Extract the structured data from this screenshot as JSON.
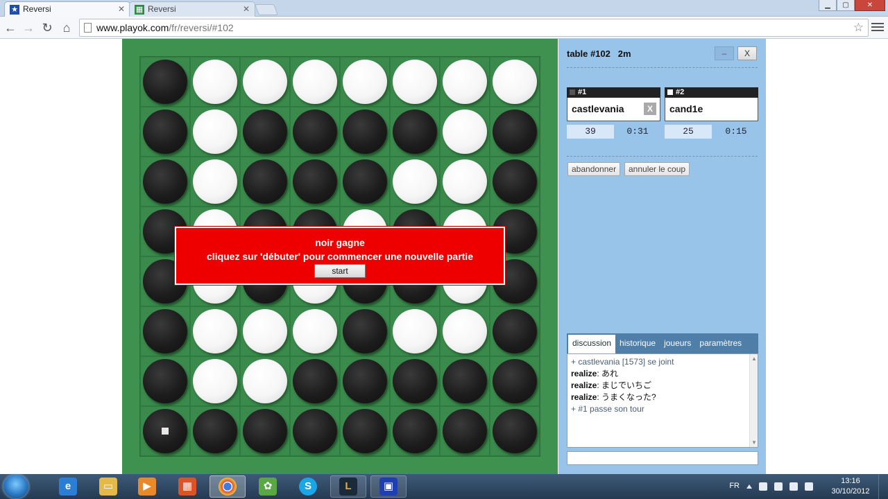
{
  "browser": {
    "tabs": [
      {
        "label": "Reversi",
        "active": true
      },
      {
        "label": "Reversi",
        "active": false
      }
    ],
    "url_host": "www.playok.com",
    "url_path": "/fr/reversi/#102"
  },
  "game": {
    "board": [
      "BWWWWWWW",
      "BWBBBBWB",
      "BWBBBWWB",
      "BWBBWBWB",
      "BWBWBBWB",
      "BWWWBWWB",
      "BWWBBBBB",
      "BBBBBBBB"
    ],
    "last_move": [
      7,
      0
    ],
    "overlay": {
      "line1": "noir gagne",
      "line2": "cliquez sur 'débuter' pour commencer une nouvelle partie",
      "start_label": "start"
    }
  },
  "panel": {
    "title": "table #102   2m",
    "minimize_label": "–",
    "close_label": "X",
    "seat1": {
      "num": "#1",
      "name": "castlevania",
      "kick": "X",
      "score": "39",
      "clock": "0:31"
    },
    "seat2": {
      "num": "#2",
      "name": "cand1e",
      "score": "25",
      "clock": "0:15"
    },
    "resign_label": "abandonner",
    "undo_label": "annuler le coup",
    "chat_tabs": [
      "discussion",
      "historique",
      "joueurs",
      "paramètres"
    ],
    "chat": [
      {
        "type": "sys",
        "text": "+ castlevania [1573] se joint"
      },
      {
        "type": "msg",
        "nick": "realize",
        "text": ": あれ"
      },
      {
        "type": "msg",
        "nick": "realize",
        "text": ": まじでいちご"
      },
      {
        "type": "msg",
        "nick": "realize",
        "text": ": うまくなった?"
      },
      {
        "type": "sys",
        "text": "+ #1 passe son tour"
      }
    ]
  },
  "taskbar": {
    "lang": "FR",
    "time": "13:16",
    "date": "30/10/2012"
  },
  "colors": {
    "board_bg": "#3f9150",
    "panel_bg": "#99c4ea",
    "overlay_red": "#ef0000"
  }
}
